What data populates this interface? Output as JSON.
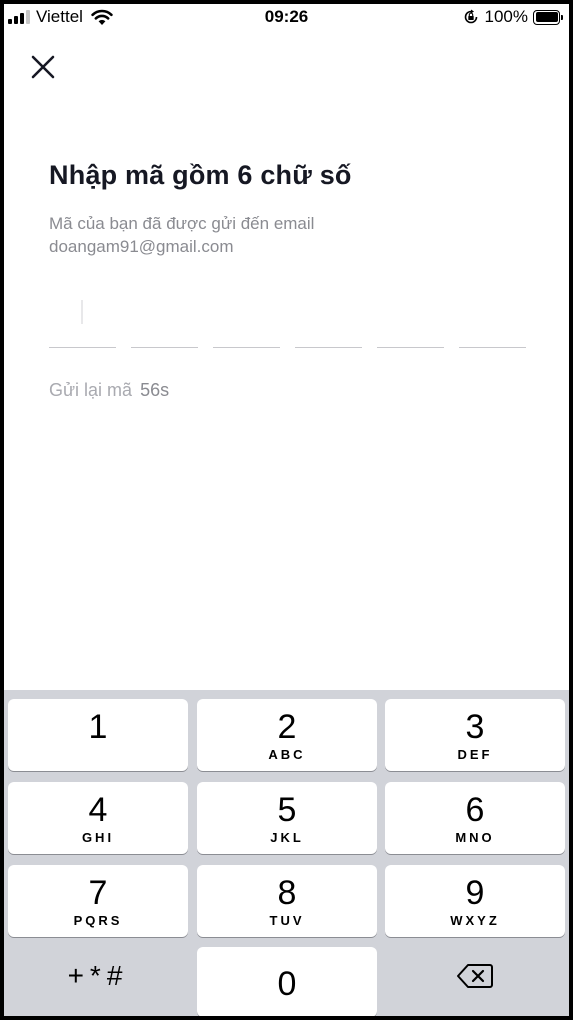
{
  "status_bar": {
    "carrier": "Viettel",
    "time": "09:26",
    "battery": "100%"
  },
  "screen": {
    "title": "Nhập mã gồm 6 chữ số",
    "subtitle_line1": "Mã của bạn đã được gửi đến email",
    "subtitle_line2": "doangam91@gmail.com",
    "resend_label": "Gửi lại mã",
    "resend_timer": "56s"
  },
  "keypad": {
    "keys": [
      {
        "digit": "1",
        "letters": ""
      },
      {
        "digit": "2",
        "letters": "ABC"
      },
      {
        "digit": "3",
        "letters": "DEF"
      },
      {
        "digit": "4",
        "letters": "GHI"
      },
      {
        "digit": "5",
        "letters": "JKL"
      },
      {
        "digit": "6",
        "letters": "MNO"
      },
      {
        "digit": "7",
        "letters": "PQRS"
      },
      {
        "digit": "8",
        "letters": "TUV"
      },
      {
        "digit": "9",
        "letters": "WXYZ"
      }
    ],
    "symbols": "+*#",
    "zero": "0"
  },
  "icons": {
    "close": "close-icon",
    "backspace": "backspace-icon",
    "wifi": "wifi-icon",
    "signal": "signal-icon",
    "battery": "battery-icon",
    "orientation_lock": "orientation-lock-icon"
  }
}
